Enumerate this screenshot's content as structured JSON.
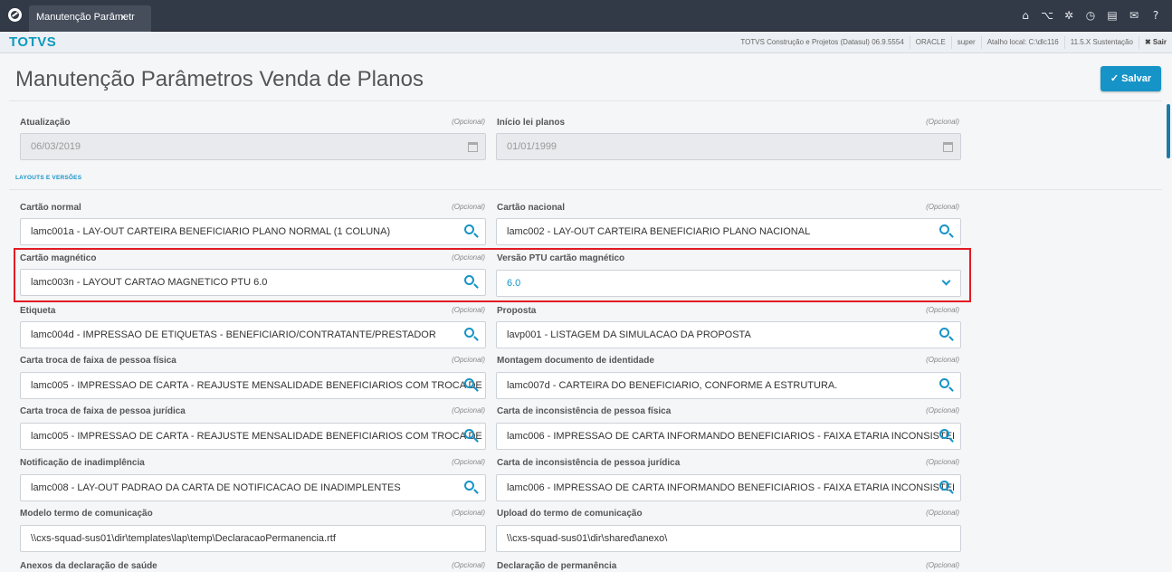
{
  "tab": {
    "title": "Manutenção Parâmetr",
    "close": "x"
  },
  "topbar_icons": [
    "home-icon",
    "sitemap-icon",
    "gear-icon",
    "clock-icon",
    "document-icon",
    "mail-icon",
    "help-icon"
  ],
  "header": {
    "brand": "TOTVS",
    "company": "TOTVS Construção e Projetos (Datasul) 06.9.5554",
    "db": "ORACLE",
    "user": "super",
    "shortcut": "Atalho local: C:\\dlc116",
    "version": "11.5.X Sustentação",
    "exit": "✖ Sair"
  },
  "page": {
    "title": "Manutenção Parâmetros Venda de Planos",
    "save": "✓ Salvar"
  },
  "optional": "(Opcional)",
  "fields": {
    "atualizacao": {
      "label": "Atualização",
      "value": "06/03/2019"
    },
    "inicio": {
      "label": "Início lei planos",
      "value": "01/01/1999"
    },
    "section": "LAYOUTS E VERSÕES",
    "cartao_normal": {
      "label": "Cartão normal",
      "value": "lamc001a - LAY-OUT CARTEIRA BENEFICIARIO PLANO NORMAL (1 COLUNA)"
    },
    "cartao_nacional": {
      "label": "Cartão nacional",
      "value": "lamc002 - LAY-OUT CARTEIRA BENEFICIARIO PLANO NACIONAL"
    },
    "cartao_magnetico": {
      "label": "Cartão magnético",
      "value": "lamc003n - LAYOUT CARTAO MAGNETICO PTU 6.0"
    },
    "versao_ptu": {
      "label": "Versão PTU cartão magnético",
      "value": "6.0"
    },
    "etiqueta": {
      "label": "Etiqueta",
      "value": "lamc004d - IMPRESSAO DE ETIQUETAS - BENEFICIARIO/CONTRATANTE/PRESTADOR"
    },
    "proposta": {
      "label": "Proposta",
      "value": "lavp001 - LISTAGEM DA SIMULACAO DA PROPOSTA"
    },
    "carta_fisica": {
      "label": "Carta troca de faixa de pessoa física",
      "value": "lamc005 - IMPRESSAO DE CARTA - REAJUSTE MENSALIDADE BENEFICIARIOS COM TROCA DE"
    },
    "montagem_doc": {
      "label": "Montagem documento de identidade",
      "value": "lamc007d - CARTEIRA DO BENEFICIARIO, CONFORME A ESTRUTURA."
    },
    "carta_juridica": {
      "label": "Carta troca de faixa de pessoa jurídica",
      "value": "lamc005 - IMPRESSAO DE CARTA - REAJUSTE MENSALIDADE BENEFICIARIOS COM TROCA DE"
    },
    "inconsistencia_fisica": {
      "label": "Carta de inconsistência de pessoa física",
      "value": "lamc006 - IMPRESSAO DE CARTA INFORMANDO BENEFICIARIOS - FAIXA ETARIA INCONSISTEI"
    },
    "notificacao": {
      "label": "Notificação de inadimplência",
      "value": "lamc008 - LAY-OUT PADRAO DA CARTA DE NOTIFICACAO DE INADIMPLENTES"
    },
    "inconsistencia_juridica": {
      "label": "Carta de inconsistência de pessoa jurídica",
      "value": "lamc006 - IMPRESSAO DE CARTA INFORMANDO BENEFICIARIOS - FAIXA ETARIA INCONSISTEI"
    },
    "modelo_termo": {
      "label": "Modelo termo de comunicação",
      "value": "\\\\cxs-squad-sus01\\dir\\templates\\lap\\temp\\DeclaracaoPermanencia.rtf"
    },
    "upload_termo": {
      "label": "Upload do termo de comunicação",
      "value": "\\\\cxs-squad-sus01\\dir\\shared\\anexo\\"
    },
    "anexos": {
      "label": "Anexos da declaração de saúde"
    },
    "declaracao": {
      "label": "Declaração de permanência"
    }
  }
}
